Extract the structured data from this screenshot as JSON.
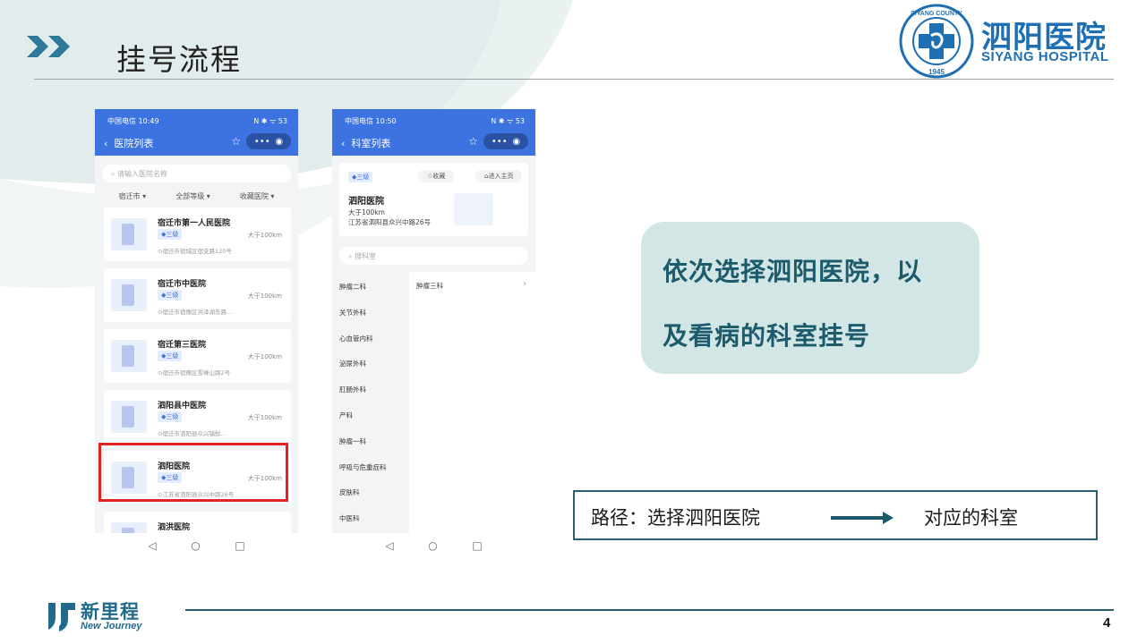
{
  "slide": {
    "title": "挂号流程",
    "page_number": "4"
  },
  "logo": {
    "emblem_top": "SIYANG COUNTY",
    "emblem_year": "1945",
    "name_cn": "泗阳医院",
    "name_en": "SIYANG HOSPITAL"
  },
  "phone1": {
    "status_time": "中国电信 10:49",
    "status_icons": "N ✱ ᯤ 53",
    "nav_title": "医院列表",
    "search_placeholder": "请输入医院名称",
    "filters": [
      "宿迁市",
      "全部等级",
      "收藏医院"
    ],
    "hospitals": [
      {
        "name": "宿迁市第一人民医院",
        "level": "三级",
        "distance": "大于100km",
        "address": "宿迁市宿城区宿支路120号"
      },
      {
        "name": "宿迁市中医院",
        "level": "三级",
        "distance": "大于100km",
        "address": "宿迁市宿豫区洪泽湖东路..."
      },
      {
        "name": "宿迁第三医院",
        "level": "三级",
        "distance": "大于100km",
        "address": "宿迁市宿豫区雪峰山路2号"
      },
      {
        "name": "泗阳县中医院",
        "level": "三级",
        "distance": "大于100km",
        "address": "宿迁市泗阳县众兴镇鲜..."
      },
      {
        "name": "泗阳医院",
        "level": "三级",
        "distance": "大于100km",
        "address": "江苏省泗阳县众兴中路26号"
      },
      {
        "name": "泗洪医院",
        "level": "",
        "distance": "",
        "address": ""
      }
    ],
    "navbar": [
      "◁",
      "○",
      "□"
    ]
  },
  "phone2": {
    "status_time": "中国电信 10:50",
    "status_icons": "N ✱ ᯤ 53",
    "nav_title": "科室列表",
    "info": {
      "level": "三级",
      "fav": "☆收藏",
      "home": "⌂进入主页",
      "name": "泗阳医院",
      "distance": "大于100km",
      "address": "江苏省泗阳县众兴中路26号"
    },
    "dept_search_placeholder": "搜科室",
    "departments": [
      "肿瘤二科",
      "关节外科",
      "心血管内科",
      "泌尿外科",
      "肛肠外科",
      "产科",
      "肿瘤一科",
      "呼吸与危重症科",
      "皮肤科",
      "中医科"
    ],
    "sub_department": "肿瘤三科",
    "navbar": [
      "◁",
      "○",
      "□"
    ]
  },
  "callout": {
    "line1": "依次选择泗阳医院，以",
    "line2": "及看病的科室挂号"
  },
  "path": {
    "label": "路径：选择泗阳医院",
    "target": "对应的科室"
  },
  "footer": {
    "brand_cn": "新里程",
    "brand_en": "New Journey"
  },
  "colors": {
    "accent": "#1c5b6b",
    "app_blue": "#3d73e0",
    "highlight": "#e02424",
    "callout_bg": "#d3e6e6"
  }
}
